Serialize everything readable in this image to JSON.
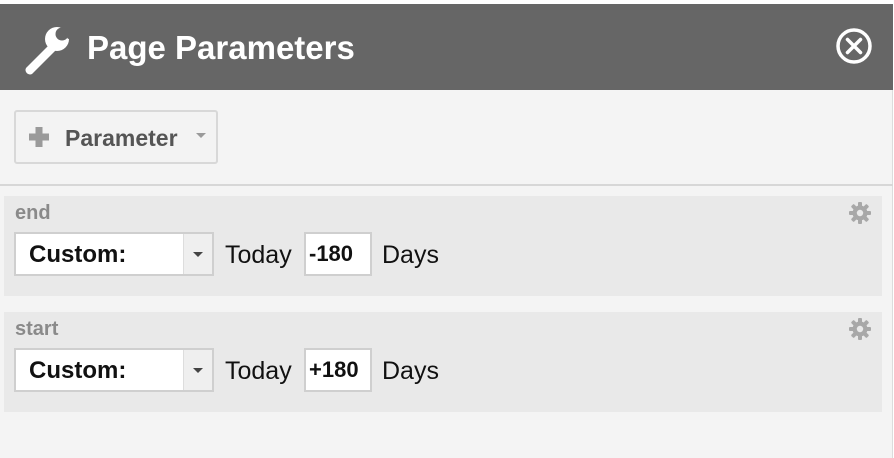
{
  "window": {
    "title": "Page Parameters",
    "title_icon": "wrench-icon",
    "close_icon": "close-circle-icon"
  },
  "toolbar": {
    "add_parameter_label": "Parameter",
    "add_icon": "plus-icon",
    "dropdown_icon": "caret-down-icon"
  },
  "parameters": [
    {
      "name": "end",
      "mode": "Custom:",
      "base_label": "Today",
      "offset": "-180",
      "unit_label": "Days",
      "settings_icon": "gear-icon"
    },
    {
      "name": "start",
      "mode": "Custom:",
      "base_label": "Today",
      "offset": "+180",
      "unit_label": "Days",
      "settings_icon": "gear-icon"
    }
  ],
  "colors": {
    "titlebar_bg": "#666666",
    "panel_bg": "#f4f4f4",
    "row_bg": "#e9e9e9",
    "title_text": "#ffffff",
    "param_name_text": "#8a8a8a"
  }
}
